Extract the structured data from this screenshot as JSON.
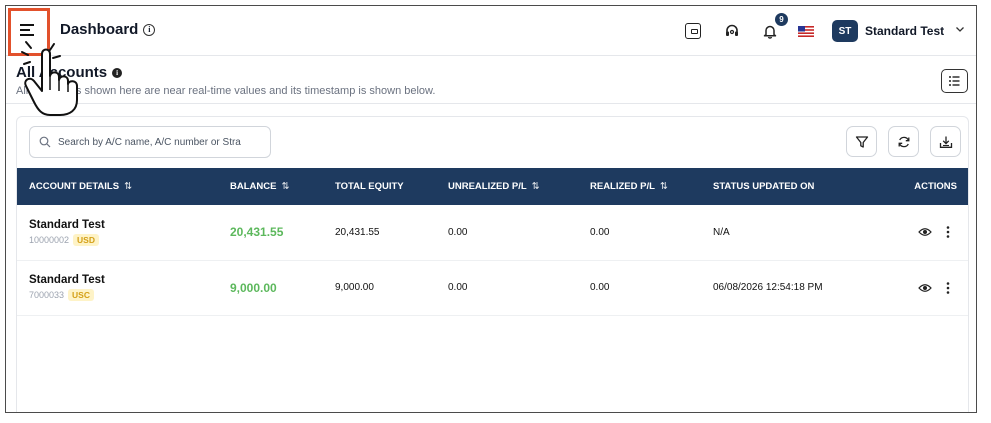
{
  "header": {
    "title": "Dashboard",
    "notification_count": "9",
    "user": {
      "initials": "ST",
      "name": "Standard Test"
    }
  },
  "page": {
    "title": "All Accounts",
    "subtitle": "All the values shown here are near real-time values and its timestamp is shown below."
  },
  "search": {
    "placeholder": "Search by A/C name, A/C number or Stra"
  },
  "table": {
    "columns": [
      {
        "label": "ACCOUNT DETAILS",
        "sortable": true
      },
      {
        "label": "BALANCE",
        "sortable": true
      },
      {
        "label": "TOTAL EQUITY",
        "sortable": false
      },
      {
        "label": "UNREALIZED P/L",
        "sortable": true
      },
      {
        "label": "REALIZED P/L",
        "sortable": true
      },
      {
        "label": "STATUS UPDATED ON",
        "sortable": false
      },
      {
        "label": "ACTIONS",
        "sortable": false
      }
    ],
    "sort_glyph": "⇅",
    "rows": [
      {
        "name": "Standard Test",
        "number": "10000002",
        "currency": "USD",
        "balance": "20,431.55",
        "equity": "20,431.55",
        "unrealized": "0.00",
        "realized": "0.00",
        "status_updated": "N/A"
      },
      {
        "name": "Standard Test",
        "number": "7000033",
        "currency": "USC",
        "balance": "9,000.00",
        "equity": "9,000.00",
        "unrealized": "0.00",
        "realized": "0.00",
        "status_updated": "06/08/2026 12:54:18 PM"
      }
    ]
  },
  "colors": {
    "primary": "#1e3a5f",
    "highlight": "#e2512c",
    "balance_green": "#5cb85c",
    "currency_badge": "#fef3c7"
  }
}
